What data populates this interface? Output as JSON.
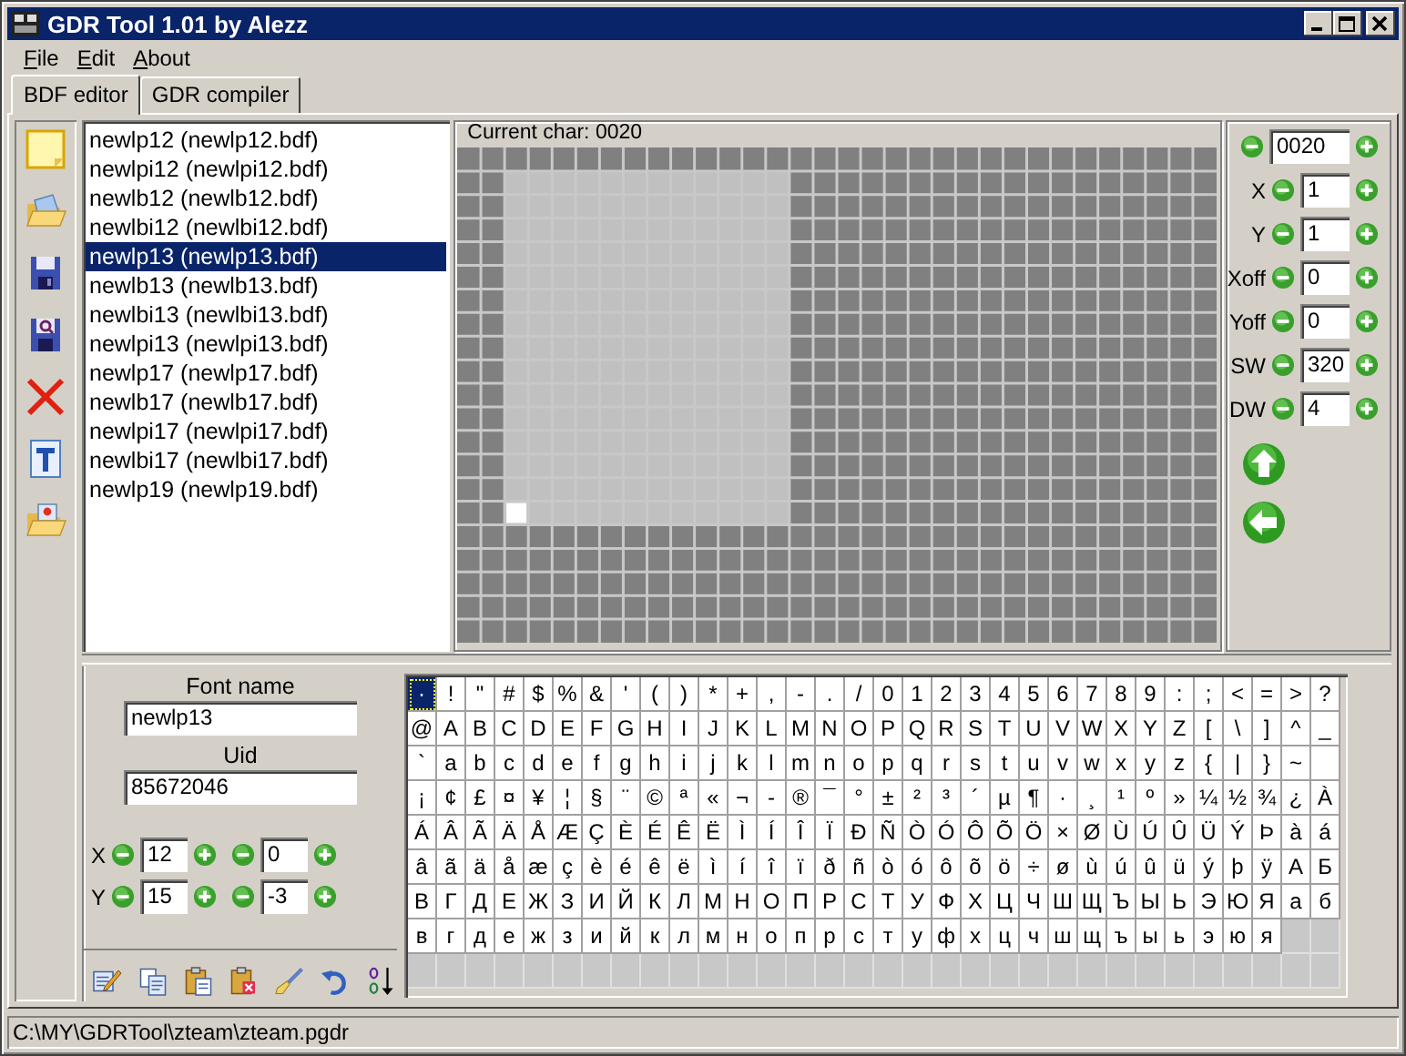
{
  "window": {
    "title": "GDR Tool 1.01 by Alezz"
  },
  "menu": [
    {
      "label": "File"
    },
    {
      "label": "Edit"
    },
    {
      "label": "About"
    }
  ],
  "tabs": [
    {
      "label": "BDF editor",
      "selected": true
    },
    {
      "label": "GDR compiler",
      "selected": false
    }
  ],
  "fonts": [
    {
      "label": "newlp12 (newlp12.bdf)",
      "selected": false
    },
    {
      "label": "newlpi12 (newlpi12.bdf)",
      "selected": false
    },
    {
      "label": "newlb12 (newlb12.bdf)",
      "selected": false
    },
    {
      "label": "newlbi12 (newlbi12.bdf)",
      "selected": false
    },
    {
      "label": "newlp13 (newlp13.bdf)",
      "selected": true
    },
    {
      "label": "newlb13 (newlb13.bdf)",
      "selected": false
    },
    {
      "label": "newlbi13 (newlbi13.bdf)",
      "selected": false
    },
    {
      "label": "newlpi13 (newlpi13.bdf)",
      "selected": false
    },
    {
      "label": "newlp17 (newlp17.bdf)",
      "selected": false
    },
    {
      "label": "newlb17 (newlb17.bdf)",
      "selected": false
    },
    {
      "label": "newlpi17 (newlpi17.bdf)",
      "selected": false
    },
    {
      "label": "newlbi17 (newlbi17.bdf)",
      "selected": false
    },
    {
      "label": "newlp19 (newlp19.bdf)",
      "selected": false
    }
  ],
  "editor": {
    "title": "Current char: 0020"
  },
  "char_props": {
    "code": "0020",
    "fields": [
      {
        "label": "X",
        "value": "1"
      },
      {
        "label": "Y",
        "value": "1"
      },
      {
        "label": "Xoff",
        "value": "0"
      },
      {
        "label": "Yoff",
        "value": "0"
      },
      {
        "label": "SW",
        "value": "320"
      },
      {
        "label": "DW",
        "value": "4"
      }
    ]
  },
  "font_info": {
    "name_label": "Font name",
    "name": "newlp13",
    "uid_label": "Uid",
    "uid": "85672046",
    "rows": [
      {
        "label": "X",
        "value_1": "12",
        "value_2": "0"
      },
      {
        "label": "Y",
        "value_1": "15",
        "value_2": "-3"
      }
    ]
  },
  "charmap": {
    "rows": [
      [
        {
          "ch": "·",
          "selected": true
        },
        {
          "ch": "!",
          "selected": false
        },
        {
          "ch": "\"",
          "selected": false
        },
        {
          "ch": "#",
          "selected": false
        },
        {
          "ch": "$",
          "selected": false
        },
        {
          "ch": "%",
          "selected": false
        },
        {
          "ch": "&",
          "selected": false
        },
        {
          "ch": "'",
          "selected": false
        },
        {
          "ch": "(",
          "selected": false
        },
        {
          "ch": ")",
          "selected": false
        },
        {
          "ch": "*",
          "selected": false
        },
        {
          "ch": "+",
          "selected": false
        },
        {
          "ch": ",",
          "selected": false
        },
        {
          "ch": "-",
          "selected": false
        },
        {
          "ch": ".",
          "selected": false
        },
        {
          "ch": "/",
          "selected": false
        },
        {
          "ch": "0",
          "selected": false
        },
        {
          "ch": "1",
          "selected": false
        },
        {
          "ch": "2",
          "selected": false
        },
        {
          "ch": "3",
          "selected": false
        },
        {
          "ch": "4",
          "selected": false
        },
        {
          "ch": "5",
          "selected": false
        },
        {
          "ch": "6",
          "selected": false
        },
        {
          "ch": "7",
          "selected": false
        },
        {
          "ch": "8",
          "selected": false
        },
        {
          "ch": "9",
          "selected": false
        },
        {
          "ch": ":",
          "selected": false
        },
        {
          "ch": ";",
          "selected": false
        },
        {
          "ch": "<",
          "selected": false
        },
        {
          "ch": "=",
          "selected": false
        },
        {
          "ch": ">",
          "selected": false
        },
        {
          "ch": "?",
          "selected": false
        }
      ],
      [
        {
          "ch": "@",
          "selected": false
        },
        {
          "ch": "A",
          "selected": false
        },
        {
          "ch": "B",
          "selected": false
        },
        {
          "ch": "C",
          "selected": false
        },
        {
          "ch": "D",
          "selected": false
        },
        {
          "ch": "E",
          "selected": false
        },
        {
          "ch": "F",
          "selected": false
        },
        {
          "ch": "G",
          "selected": false
        },
        {
          "ch": "H",
          "selected": false
        },
        {
          "ch": "I",
          "selected": false
        },
        {
          "ch": "J",
          "selected": false
        },
        {
          "ch": "K",
          "selected": false
        },
        {
          "ch": "L",
          "selected": false
        },
        {
          "ch": "M",
          "selected": false
        },
        {
          "ch": "N",
          "selected": false
        },
        {
          "ch": "O",
          "selected": false
        },
        {
          "ch": "P",
          "selected": false
        },
        {
          "ch": "Q",
          "selected": false
        },
        {
          "ch": "R",
          "selected": false
        },
        {
          "ch": "S",
          "selected": false
        },
        {
          "ch": "T",
          "selected": false
        },
        {
          "ch": "U",
          "selected": false
        },
        {
          "ch": "V",
          "selected": false
        },
        {
          "ch": "W",
          "selected": false
        },
        {
          "ch": "X",
          "selected": false
        },
        {
          "ch": "Y",
          "selected": false
        },
        {
          "ch": "Z",
          "selected": false
        },
        {
          "ch": "[",
          "selected": false
        },
        {
          "ch": "\\",
          "selected": false
        },
        {
          "ch": "]",
          "selected": false
        },
        {
          "ch": "^",
          "selected": false
        },
        {
          "ch": "_",
          "selected": false
        }
      ],
      [
        {
          "ch": "`",
          "selected": false
        },
        {
          "ch": "a",
          "selected": false
        },
        {
          "ch": "b",
          "selected": false
        },
        {
          "ch": "c",
          "selected": false
        },
        {
          "ch": "d",
          "selected": false
        },
        {
          "ch": "e",
          "selected": false
        },
        {
          "ch": "f",
          "selected": false
        },
        {
          "ch": "g",
          "selected": false
        },
        {
          "ch": "h",
          "selected": false
        },
        {
          "ch": "i",
          "selected": false
        },
        {
          "ch": "j",
          "selected": false
        },
        {
          "ch": "k",
          "selected": false
        },
        {
          "ch": "l",
          "selected": false
        },
        {
          "ch": "m",
          "selected": false
        },
        {
          "ch": "n",
          "selected": false
        },
        {
          "ch": "o",
          "selected": false
        },
        {
          "ch": "p",
          "selected": false
        },
        {
          "ch": "q",
          "selected": false
        },
        {
          "ch": "r",
          "selected": false
        },
        {
          "ch": "s",
          "selected": false
        },
        {
          "ch": "t",
          "selected": false
        },
        {
          "ch": "u",
          "selected": false
        },
        {
          "ch": "v",
          "selected": false
        },
        {
          "ch": "w",
          "selected": false
        },
        {
          "ch": "x",
          "selected": false
        },
        {
          "ch": "y",
          "selected": false
        },
        {
          "ch": "z",
          "selected": false
        },
        {
          "ch": "{",
          "selected": false
        },
        {
          "ch": "|",
          "selected": false
        },
        {
          "ch": "}",
          "selected": false
        },
        {
          "ch": "~",
          "selected": false
        }
      ],
      [
        {
          "ch": "¡",
          "selected": false
        },
        {
          "ch": "¢",
          "selected": false
        },
        {
          "ch": "£",
          "selected": false
        },
        {
          "ch": "¤",
          "selected": false
        },
        {
          "ch": "¥",
          "selected": false
        },
        {
          "ch": "¦",
          "selected": false
        },
        {
          "ch": "§",
          "selected": false
        },
        {
          "ch": "¨",
          "selected": false
        },
        {
          "ch": "©",
          "selected": false
        },
        {
          "ch": "ª",
          "selected": false
        },
        {
          "ch": "«",
          "selected": false
        },
        {
          "ch": "¬",
          "selected": false
        },
        {
          "ch": "-",
          "selected": false
        },
        {
          "ch": "®",
          "selected": false
        },
        {
          "ch": "¯",
          "selected": false
        },
        {
          "ch": "°",
          "selected": false
        },
        {
          "ch": "±",
          "selected": false
        },
        {
          "ch": "²",
          "selected": false
        },
        {
          "ch": "³",
          "selected": false
        },
        {
          "ch": "´",
          "selected": false
        },
        {
          "ch": "µ",
          "selected": false
        },
        {
          "ch": "¶",
          "selected": false
        },
        {
          "ch": "·",
          "selected": false
        },
        {
          "ch": "¸",
          "selected": false
        },
        {
          "ch": "¹",
          "selected": false
        },
        {
          "ch": "º",
          "selected": false
        },
        {
          "ch": "»",
          "selected": false
        },
        {
          "ch": "¼",
          "selected": false
        },
        {
          "ch": "½",
          "selected": false
        },
        {
          "ch": "¾",
          "selected": false
        },
        {
          "ch": "¿",
          "selected": false
        },
        {
          "ch": "À",
          "selected": false
        }
      ],
      [
        {
          "ch": "Á",
          "selected": false
        },
        {
          "ch": "Â",
          "selected": false
        },
        {
          "ch": "Ã",
          "selected": false
        },
        {
          "ch": "Ä",
          "selected": false
        },
        {
          "ch": "Å",
          "selected": false
        },
        {
          "ch": "Æ",
          "selected": false
        },
        {
          "ch": "Ç",
          "selected": false
        },
        {
          "ch": "È",
          "selected": false
        },
        {
          "ch": "É",
          "selected": false
        },
        {
          "ch": "Ê",
          "selected": false
        },
        {
          "ch": "Ë",
          "selected": false
        },
        {
          "ch": "Ì",
          "selected": false
        },
        {
          "ch": "Í",
          "selected": false
        },
        {
          "ch": "Î",
          "selected": false
        },
        {
          "ch": "Ï",
          "selected": false
        },
        {
          "ch": "Ð",
          "selected": false
        },
        {
          "ch": "Ñ",
          "selected": false
        },
        {
          "ch": "Ò",
          "selected": false
        },
        {
          "ch": "Ó",
          "selected": false
        },
        {
          "ch": "Ô",
          "selected": false
        },
        {
          "ch": "Õ",
          "selected": false
        },
        {
          "ch": "Ö",
          "selected": false
        },
        {
          "ch": "×",
          "selected": false
        },
        {
          "ch": "Ø",
          "selected": false
        },
        {
          "ch": "Ù",
          "selected": false
        },
        {
          "ch": "Ú",
          "selected": false
        },
        {
          "ch": "Û",
          "selected": false
        },
        {
          "ch": "Ü",
          "selected": false
        },
        {
          "ch": "Ý",
          "selected": false
        },
        {
          "ch": "Þ",
          "selected": false
        },
        {
          "ch": "à",
          "selected": false
        },
        {
          "ch": "á",
          "selected": false
        }
      ],
      [
        {
          "ch": "â",
          "selected": false
        },
        {
          "ch": "ã",
          "selected": false
        },
        {
          "ch": "ä",
          "selected": false
        },
        {
          "ch": "å",
          "selected": false
        },
        {
          "ch": "æ",
          "selected": false
        },
        {
          "ch": "ç",
          "selected": false
        },
        {
          "ch": "è",
          "selected": false
        },
        {
          "ch": "é",
          "selected": false
        },
        {
          "ch": "ê",
          "selected": false
        },
        {
          "ch": "ë",
          "selected": false
        },
        {
          "ch": "ì",
          "selected": false
        },
        {
          "ch": "í",
          "selected": false
        },
        {
          "ch": "î",
          "selected": false
        },
        {
          "ch": "ï",
          "selected": false
        },
        {
          "ch": "ð",
          "selected": false
        },
        {
          "ch": "ñ",
          "selected": false
        },
        {
          "ch": "ò",
          "selected": false
        },
        {
          "ch": "ó",
          "selected": false
        },
        {
          "ch": "ô",
          "selected": false
        },
        {
          "ch": "õ",
          "selected": false
        },
        {
          "ch": "ö",
          "selected": false
        },
        {
          "ch": "÷",
          "selected": false
        },
        {
          "ch": "ø",
          "selected": false
        },
        {
          "ch": "ù",
          "selected": false
        },
        {
          "ch": "ú",
          "selected": false
        },
        {
          "ch": "û",
          "selected": false
        },
        {
          "ch": "ü",
          "selected": false
        },
        {
          "ch": "ý",
          "selected": false
        },
        {
          "ch": "þ",
          "selected": false
        },
        {
          "ch": "ÿ",
          "selected": false
        },
        {
          "ch": "А",
          "selected": false
        },
        {
          "ch": "Б",
          "selected": false
        }
      ],
      [
        {
          "ch": "В",
          "selected": false
        },
        {
          "ch": "Г",
          "selected": false
        },
        {
          "ch": "Д",
          "selected": false
        },
        {
          "ch": "Е",
          "selected": false
        },
        {
          "ch": "Ж",
          "selected": false
        },
        {
          "ch": "З",
          "selected": false
        },
        {
          "ch": "И",
          "selected": false
        },
        {
          "ch": "Й",
          "selected": false
        },
        {
          "ch": "К",
          "selected": false
        },
        {
          "ch": "Л",
          "selected": false
        },
        {
          "ch": "М",
          "selected": false
        },
        {
          "ch": "Н",
          "selected": false
        },
        {
          "ch": "О",
          "selected": false
        },
        {
          "ch": "П",
          "selected": false
        },
        {
          "ch": "Р",
          "selected": false
        },
        {
          "ch": "С",
          "selected": false
        },
        {
          "ch": "Т",
          "selected": false
        },
        {
          "ch": "У",
          "selected": false
        },
        {
          "ch": "Ф",
          "selected": false
        },
        {
          "ch": "Х",
          "selected": false
        },
        {
          "ch": "Ц",
          "selected": false
        },
        {
          "ch": "Ч",
          "selected": false
        },
        {
          "ch": "Ш",
          "selected": false
        },
        {
          "ch": "Щ",
          "selected": false
        },
        {
          "ch": "Ъ",
          "selected": false
        },
        {
          "ch": "Ы",
          "selected": false
        },
        {
          "ch": "Ь",
          "selected": false
        },
        {
          "ch": "Э",
          "selected": false
        },
        {
          "ch": "Ю",
          "selected": false
        },
        {
          "ch": "Я",
          "selected": false
        },
        {
          "ch": "а",
          "selected": false
        },
        {
          "ch": "б",
          "selected": false
        }
      ],
      [
        {
          "ch": "в",
          "selected": false
        },
        {
          "ch": "г",
          "selected": false
        },
        {
          "ch": "д",
          "selected": false
        },
        {
          "ch": "е",
          "selected": false
        },
        {
          "ch": "ж",
          "selected": false
        },
        {
          "ch": "з",
          "selected": false
        },
        {
          "ch": "и",
          "selected": false
        },
        {
          "ch": "й",
          "selected": false
        },
        {
          "ch": "к",
          "selected": false
        },
        {
          "ch": "л",
          "selected": false
        },
        {
          "ch": "м",
          "selected": false
        },
        {
          "ch": "н",
          "selected": false
        },
        {
          "ch": "о",
          "selected": false
        },
        {
          "ch": "п",
          "selected": false
        },
        {
          "ch": "р",
          "selected": false
        },
        {
          "ch": "с",
          "selected": false
        },
        {
          "ch": "т",
          "selected": false
        },
        {
          "ch": "у",
          "selected": false
        },
        {
          "ch": "ф",
          "selected": false
        },
        {
          "ch": "х",
          "selected": false
        },
        {
          "ch": "ц",
          "selected": false
        },
        {
          "ch": "ч",
          "selected": false
        },
        {
          "ch": "ш",
          "selected": false
        },
        {
          "ch": "щ",
          "selected": false
        },
        {
          "ch": "ъ",
          "selected": false
        },
        {
          "ch": "ы",
          "selected": false
        },
        {
          "ch": "ь",
          "selected": false
        },
        {
          "ch": "э",
          "selected": false
        },
        {
          "ch": "ю",
          "selected": false
        },
        {
          "ch": "я",
          "selected": false
        }
      ]
    ]
  },
  "status_bar": {
    "text": "C:\\MY\\GDRTool\\zteam\\zteam.pgdr"
  }
}
